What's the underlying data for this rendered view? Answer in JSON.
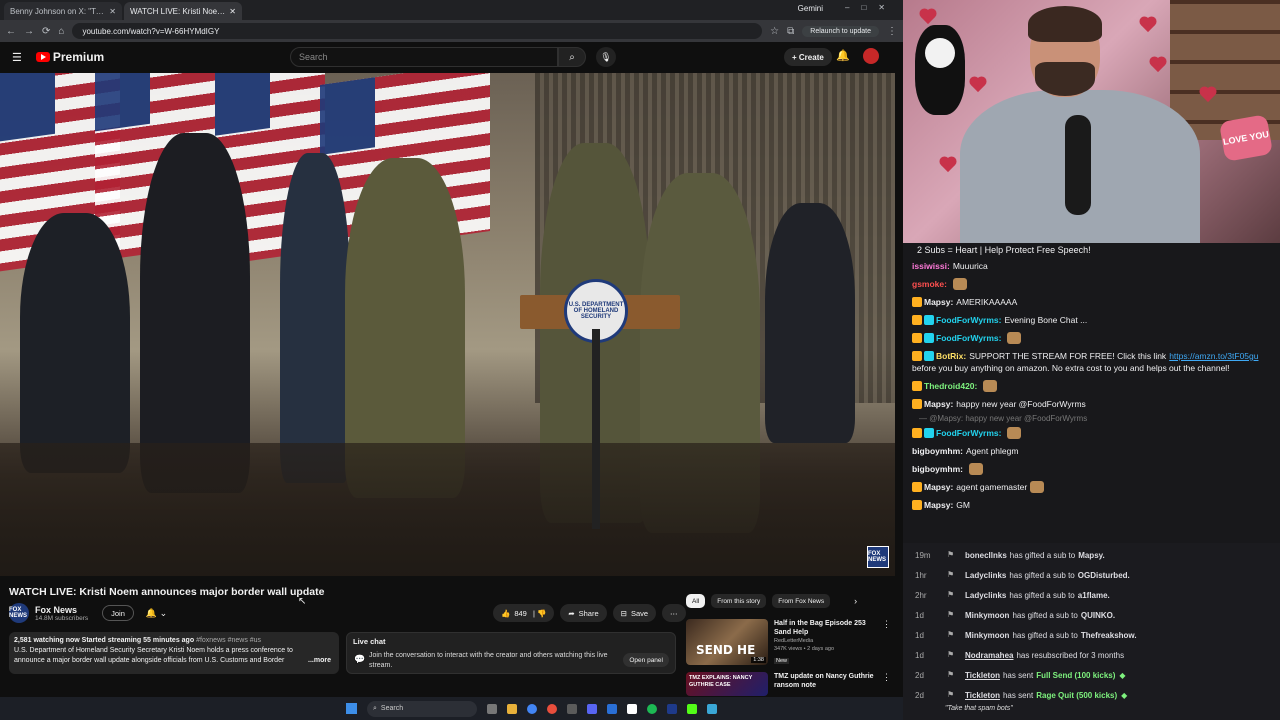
{
  "browser": {
    "tabs": [
      {
        "label": "Benny Johnson on X: \"Trump to",
        "active": false
      },
      {
        "label": "WATCH LIVE: Kristi Noem a",
        "active": true
      }
    ],
    "gemini_label": "Gemini",
    "url": "youtube.com/watch?v=W-66HYMdIGY",
    "relaunch_label": "Relaunch to update"
  },
  "youtube": {
    "logo": "Premium",
    "search_placeholder": "Search",
    "create_label": "Create",
    "video": {
      "seal_text": "U.S. DEPARTMENT OF HOMELAND SECURITY",
      "bug_text": "FOX NEWS",
      "title": "WATCH LIVE: Kristi Noem announces major border wall update"
    },
    "channel": {
      "name": "Fox News",
      "subs": "14.8M subscribers",
      "join": "Join",
      "avatar_text": "FOX NEWS"
    },
    "actions": {
      "likes": "849",
      "share": "Share",
      "save": "Save"
    },
    "description": {
      "stats": "2,581 watching now  Started streaming 55 minutes ago",
      "tags": "#foxnews #news #us",
      "text": "U.S. Department of Homeland Security Secretary Kristi Noem holds a press conference to announce a major border wall update alongside officials from U.S. Customs and Border Protection, Border",
      "more": "...more"
    },
    "live_chat": {
      "title": "Live chat",
      "message": "Join the conversation to interact with the creator and others watching this live stream.",
      "open": "Open panel"
    },
    "chips": [
      "All",
      "From this story",
      "From Fox News"
    ],
    "recommendations": [
      {
        "title": "Half in the Bag Episode 253 Sand Help",
        "channel": "RedLetterMedia",
        "meta": "347K views • 2 days ago",
        "badge": "New",
        "duration": "1:38",
        "thumb_text": "SEND HE"
      },
      {
        "title": "TMZ update on Nancy Guthrie ransom note",
        "channel": "",
        "meta": "",
        "badge": "",
        "duration": "",
        "thumb_text": "TMZ EXPLAINS: NANCY GUTHRIE CASE"
      }
    ]
  },
  "taskbar": {
    "search": "Search"
  },
  "cam": {
    "love_you": "LOVE YOU"
  },
  "chat": {
    "banner": "2 Subs = Heart | Help Protect Free Speech!",
    "messages": [
      {
        "name": "issiwissi",
        "color": "#ff7ad9",
        "text": "Muuurica",
        "badges": 0,
        "emote": false
      },
      {
        "name": "gsmoke",
        "color": "#ff4f4f",
        "text": "",
        "badges": 0,
        "emote": true
      },
      {
        "name": "Mapsy",
        "color": "#efeff1",
        "text": "AMERIKAAAAA",
        "badges": 1,
        "emote": false
      },
      {
        "name": "FoodForWyrms",
        "color": "#22d3ee",
        "text": "Evening Bone Chat ...",
        "badges": 2,
        "emote": false
      },
      {
        "name": "FoodForWyrms",
        "color": "#22d3ee",
        "text": "",
        "badges": 2,
        "emote": true
      },
      {
        "name": "BotRix",
        "color": "#ffe066",
        "text": "SUPPORT THE STREAM FOR FREE! Click this link",
        "link": "https://amzn.to/3tF05gu",
        "tail": "before you buy anything on amazon. No extra cost to you and helps out the channel!",
        "badges": 2,
        "emote": false
      },
      {
        "name": "Thedroid420",
        "color": "#7ef27e",
        "text": "",
        "badges": 1,
        "emote": true
      },
      {
        "name": "Mapsy",
        "color": "#efeff1",
        "text": "happy new year @FoodForWyrms",
        "badges": 1,
        "emote": false
      },
      {
        "name": "FoodForWyrms",
        "color": "#22d3ee",
        "text": "",
        "badges": 2,
        "emote": true,
        "reply": "@Mapsy: happy new year @FoodForWyrms"
      },
      {
        "name": "bigboymhm",
        "color": "#efeff1",
        "text": "Agent phlegm",
        "badges": 0,
        "emote": false
      },
      {
        "name": "bigboymhm",
        "color": "#efeff1",
        "text": "",
        "badges": 0,
        "emote": true
      },
      {
        "name": "Mapsy",
        "color": "#efeff1",
        "text": "agent gamemaster",
        "badges": 1,
        "emote": true
      },
      {
        "name": "Mapsy",
        "color": "#efeff1",
        "text": "GM",
        "badges": 1,
        "emote": false
      }
    ],
    "events": [
      {
        "time": "19m",
        "name": "bonecllnks",
        "text": "has gifted a sub to",
        "target": "Mapsy."
      },
      {
        "time": "1hr",
        "name": "Ladyclinks",
        "text": "has gifted a sub to",
        "target": "OGDisturbed."
      },
      {
        "time": "2hr",
        "name": "Ladyclinks",
        "text": "has gifted a sub to",
        "target": "a1flame."
      },
      {
        "time": "1d",
        "name": "Minkymoon",
        "text": "has gifted a sub to",
        "target": "QUINKO."
      },
      {
        "time": "1d",
        "name": "Minkymoon",
        "text": "has gifted a sub to",
        "target": "Thefreakshow."
      },
      {
        "time": "1d",
        "name": "Nodramahea",
        "text": "has resubscribed for 3 months",
        "target": ""
      },
      {
        "time": "2d",
        "name": "Tickleton",
        "text": "has sent",
        "highlight": "Full Send (100 kicks)",
        "target": ""
      },
      {
        "time": "2d",
        "name": "Tickleton",
        "text": "has sent",
        "highlight": "Rage Quit (500 kicks)",
        "target": "",
        "quote": "\"Take that spam bots\""
      }
    ]
  }
}
